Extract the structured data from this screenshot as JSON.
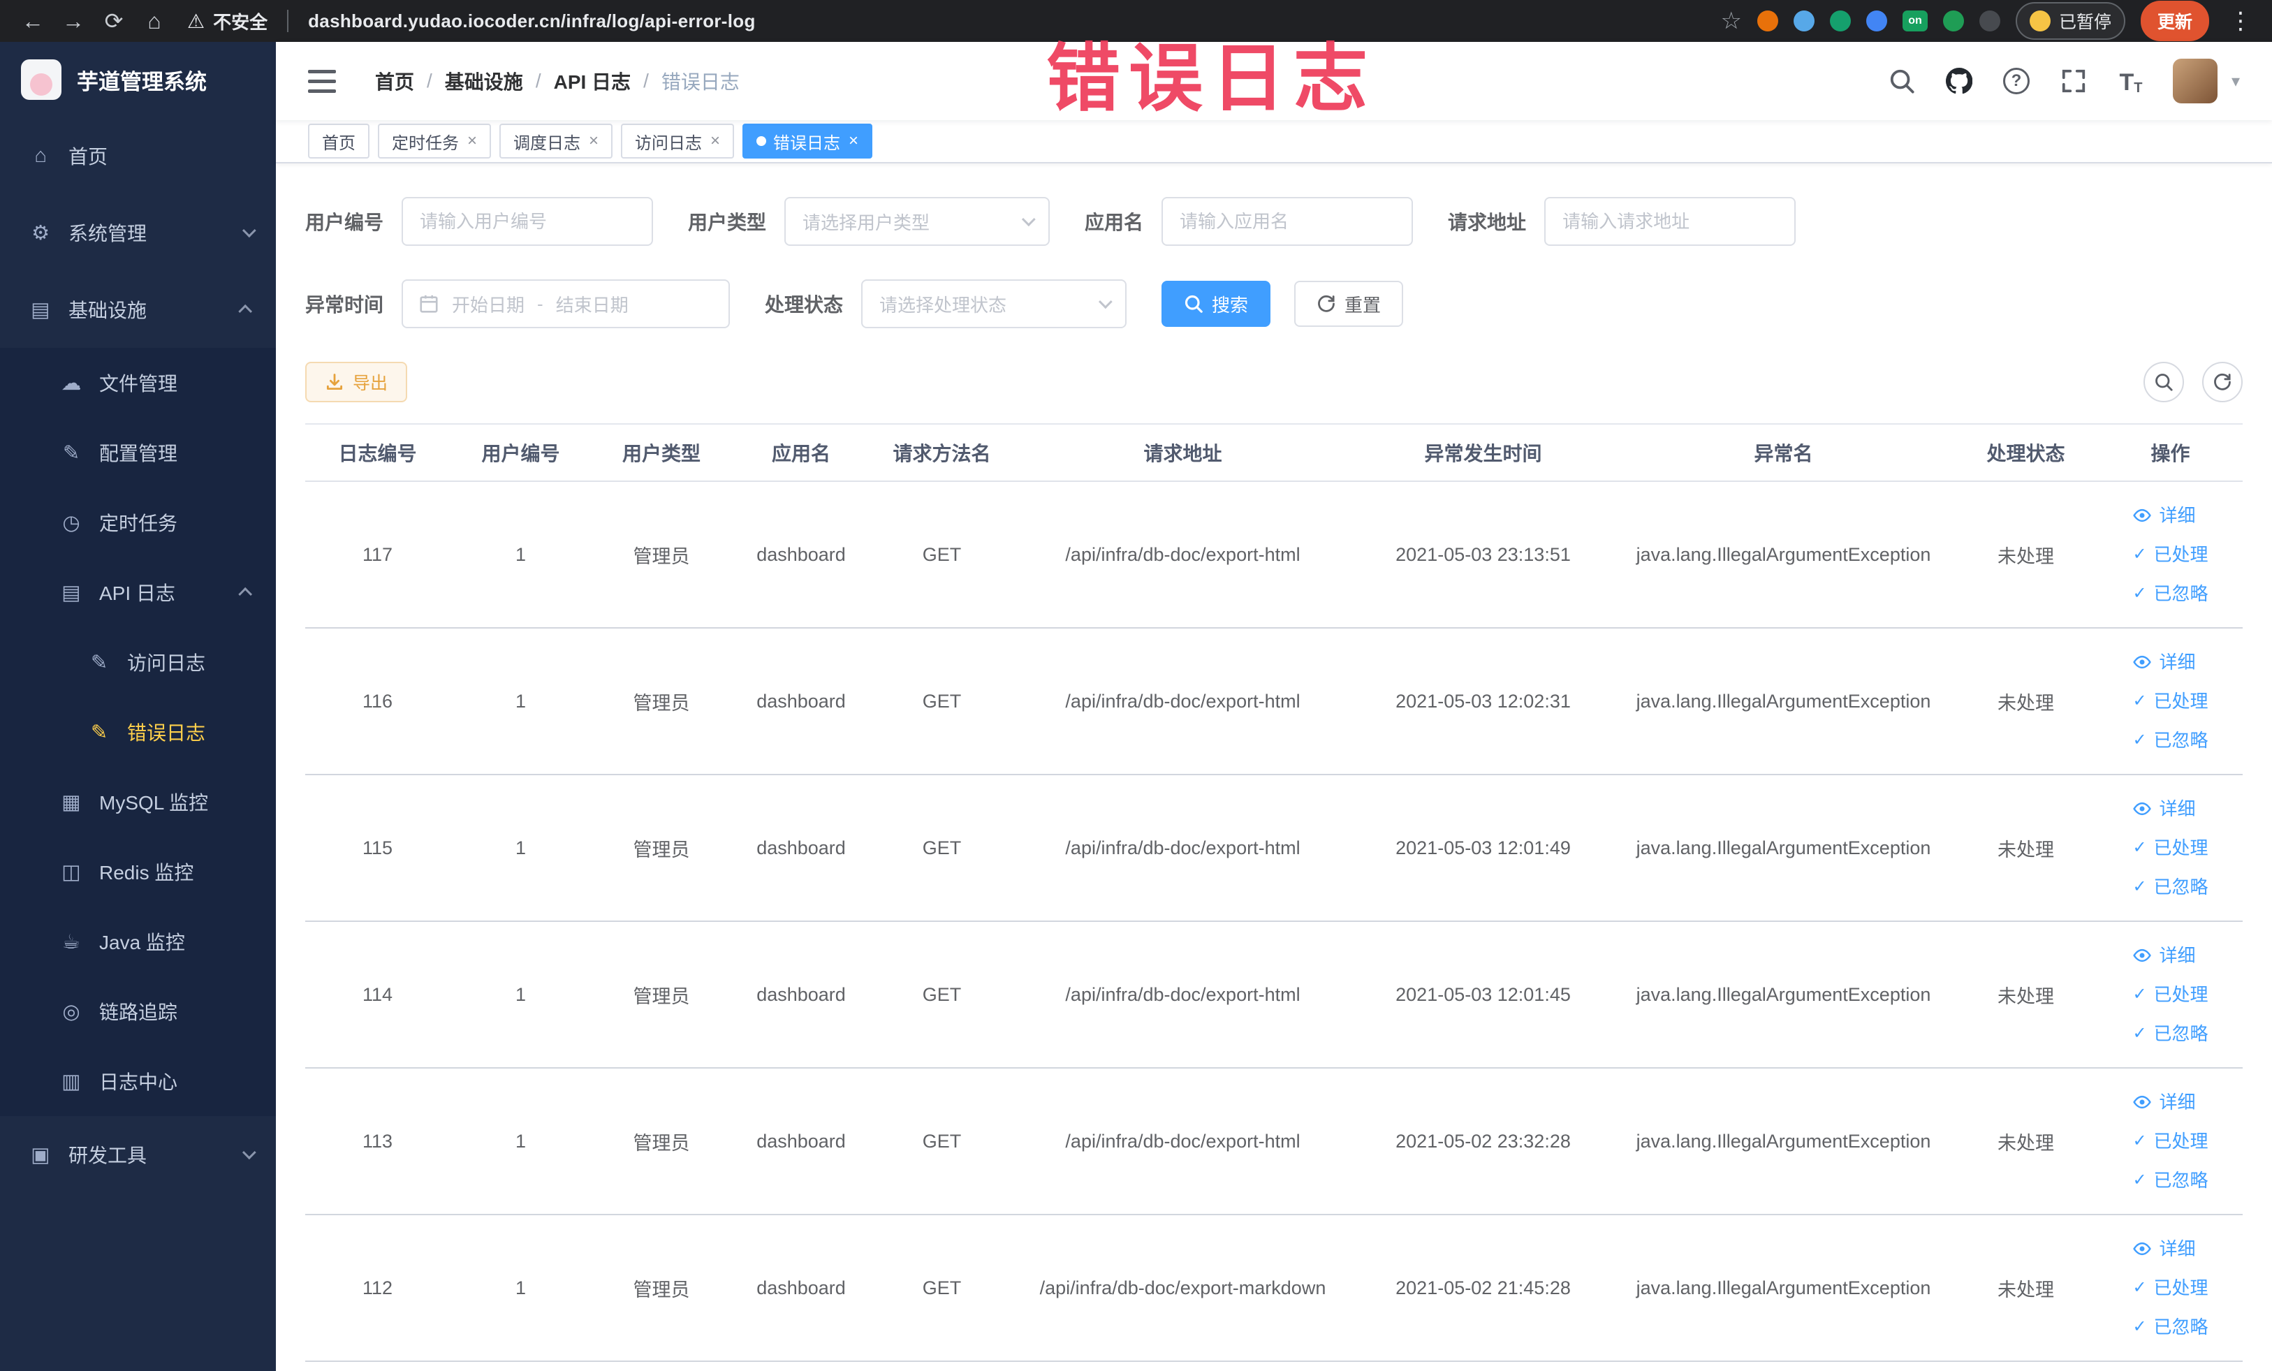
{
  "watermark": {
    "text": "错误日志",
    "color": "#ee3b5a"
  },
  "browser": {
    "security_label": "不安全",
    "url": "dashboard.yudao.iocoder.cn/infra/log/api-error-log",
    "paused_label": "已暂停",
    "update_label": "更新"
  },
  "sidebar": {
    "logo_title": "芋道管理系统",
    "items": [
      {
        "label": "首页"
      },
      {
        "label": "系统管理"
      },
      {
        "label": "基础设施"
      },
      {
        "label": "文件管理"
      },
      {
        "label": "配置管理"
      },
      {
        "label": "定时任务"
      },
      {
        "label": "API 日志"
      },
      {
        "label": "访问日志"
      },
      {
        "label": "错误日志"
      },
      {
        "label": "MySQL 监控"
      },
      {
        "label": "Redis 监控"
      },
      {
        "label": "Java 监控"
      },
      {
        "label": "链路追踪"
      },
      {
        "label": "日志中心"
      },
      {
        "label": "研发工具"
      }
    ]
  },
  "header": {
    "breadcrumb": [
      "首页",
      "基础设施",
      "API 日志",
      "错误日志"
    ]
  },
  "tabs": [
    {
      "label": "首页"
    },
    {
      "label": "定时任务"
    },
    {
      "label": "调度日志"
    },
    {
      "label": "访问日志"
    },
    {
      "label": "错误日志"
    }
  ],
  "filters": {
    "user_id": {
      "label": "用户编号",
      "placeholder": "请输入用户编号"
    },
    "user_type": {
      "label": "用户类型",
      "placeholder": "请选择用户类型"
    },
    "app_name": {
      "label": "应用名",
      "placeholder": "请输入应用名"
    },
    "request_url": {
      "label": "请求地址",
      "placeholder": "请输入请求地址"
    },
    "exception_time": {
      "label": "异常时间",
      "start_placeholder": "开始日期",
      "separator": "-",
      "end_placeholder": "结束日期"
    },
    "process_status": {
      "label": "处理状态",
      "placeholder": "请选择处理状态"
    },
    "search_label": "搜索",
    "reset_label": "重置"
  },
  "toolbar": {
    "export_label": "导出"
  },
  "table": {
    "columns": [
      "日志编号",
      "用户编号",
      "用户类型",
      "应用名",
      "请求方法名",
      "请求地址",
      "异常发生时间",
      "异常名",
      "处理状态",
      "操作"
    ],
    "action_labels": [
      "详细",
      "已处理",
      "已忽略"
    ],
    "rows": [
      {
        "id": "117",
        "user_id": "1",
        "user_type": "管理员",
        "app_name": "dashboard",
        "method": "GET",
        "url": "/api/infra/db-doc/export-html",
        "time": "2021-05-03 23:13:51",
        "exception": "java.lang.IllegalArgumentException",
        "status": "未处理"
      },
      {
        "id": "116",
        "user_id": "1",
        "user_type": "管理员",
        "app_name": "dashboard",
        "method": "GET",
        "url": "/api/infra/db-doc/export-html",
        "time": "2021-05-03 12:02:31",
        "exception": "java.lang.IllegalArgumentException",
        "status": "未处理"
      },
      {
        "id": "115",
        "user_id": "1",
        "user_type": "管理员",
        "app_name": "dashboard",
        "method": "GET",
        "url": "/api/infra/db-doc/export-html",
        "time": "2021-05-03 12:01:49",
        "exception": "java.lang.IllegalArgumentException",
        "status": "未处理"
      },
      {
        "id": "114",
        "user_id": "1",
        "user_type": "管理员",
        "app_name": "dashboard",
        "method": "GET",
        "url": "/api/infra/db-doc/export-html",
        "time": "2021-05-03 12:01:45",
        "exception": "java.lang.IllegalArgumentException",
        "status": "未处理"
      },
      {
        "id": "113",
        "user_id": "1",
        "user_type": "管理员",
        "app_name": "dashboard",
        "method": "GET",
        "url": "/api/infra/db-doc/export-html",
        "time": "2021-05-02 23:32:28",
        "exception": "java.lang.IllegalArgumentException",
        "status": "未处理"
      },
      {
        "id": "112",
        "user_id": "1",
        "user_type": "管理员",
        "app_name": "dashboard",
        "method": "GET",
        "url": "/api/infra/db-doc/export-markdown",
        "time": "2021-05-02 21:45:28",
        "exception": "java.lang.IllegalArgumentException",
        "status": "未处理"
      }
    ]
  },
  "colors": {
    "accent": "#409eff",
    "active_menu": "#ffd04b",
    "watermark": "#ee3b5a"
  }
}
